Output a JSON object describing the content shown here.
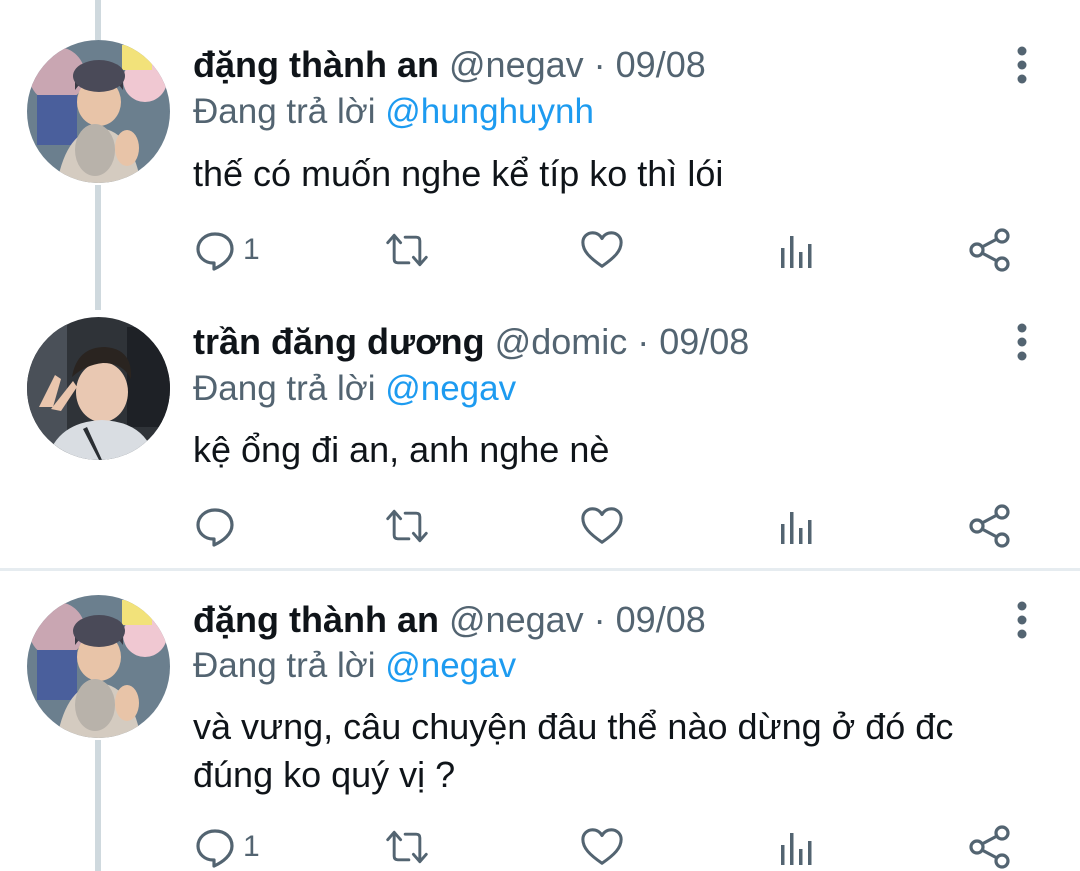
{
  "tweets": [
    {
      "display_name": "đặng thành an",
      "handle": "@negav",
      "date": "· 09/08",
      "replying_prefix": "Đang trả lời ",
      "replying_to": "@hunghuynh",
      "text": "thế có muốn nghe kể típ ko thì lói",
      "reply_count": "1"
    },
    {
      "display_name": "trần đăng dương",
      "handle": "@domic",
      "date": "· 09/08",
      "replying_prefix": "Đang trả lời ",
      "replying_to": "@negav",
      "text": "kệ ổng đi an, anh nghe nè",
      "reply_count": ""
    },
    {
      "display_name": "đặng thành an",
      "handle": "@negav",
      "date": "· 09/08",
      "replying_prefix": "Đang trả lời ",
      "replying_to": "@negav",
      "text": "và vưng, câu chuyện đâu thể nào dừng ở đó đc đúng ko quý vị ?",
      "reply_count": "1"
    }
  ],
  "colors": {
    "text": "#0f1419",
    "secondary": "#536471",
    "link": "#1d9bf0",
    "icon": "#536471",
    "thread_line": "#cfd9de"
  },
  "icons": [
    "reply-icon",
    "retweet-icon",
    "like-icon",
    "views-icon",
    "share-icon",
    "more-icon"
  ]
}
